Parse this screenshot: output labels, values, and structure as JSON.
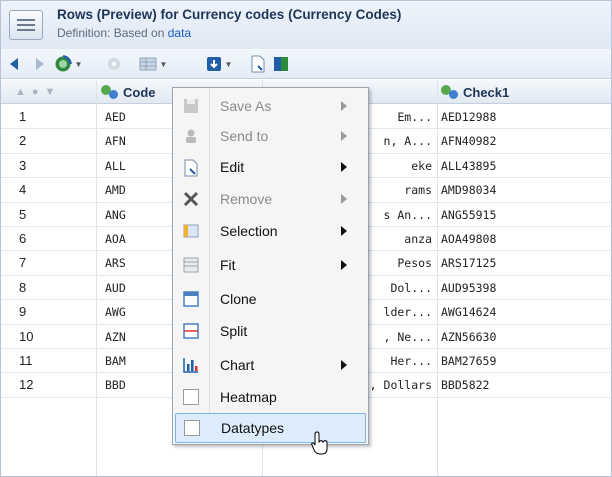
{
  "header": {
    "title": "Rows (Preview) for Currency codes (Currency Codes)",
    "definition_prefix": "Definition: Based on ",
    "definition_link": "data"
  },
  "columns": {
    "code": "Code",
    "check1": "Check1"
  },
  "rows": [
    {
      "num": "1",
      "code": "AED",
      "name": " Em...",
      "check": "AED12988"
    },
    {
      "num": "2",
      "code": "AFN",
      "name": "n, A...",
      "check": "AFN40982"
    },
    {
      "num": "3",
      "code": "ALL",
      "name": "eke",
      "check": "ALL43895"
    },
    {
      "num": "4",
      "code": "AMD",
      "name": "rams",
      "check": "AMD98034"
    },
    {
      "num": "5",
      "code": "ANG",
      "name": "s An...",
      "check": "ANG55915"
    },
    {
      "num": "6",
      "code": "AOA",
      "name": "anza",
      "check": "AOA49808"
    },
    {
      "num": "7",
      "code": "ARS",
      "name": "Pesos",
      "check": "ARS17125"
    },
    {
      "num": "8",
      "code": "AUD",
      "name": "Dol...",
      "check": "AUD95398"
    },
    {
      "num": "9",
      "code": "AWG",
      "name": "lder...",
      "check": "AWG14624"
    },
    {
      "num": "10",
      "code": "AZN",
      "name": ", Ne...",
      "check": "AZN56630"
    },
    {
      "num": "11",
      "code": "BAM",
      "name": "Her...",
      "check": "BAM27659"
    },
    {
      "num": "12",
      "code": "BBD",
      "name": "Barbados, Dollars",
      "check": "BBD5822"
    }
  ],
  "menu": {
    "items": [
      {
        "label": "Save As",
        "disabled": true,
        "submenu": true,
        "icon": "save-icon"
      },
      {
        "label": "Send to",
        "disabled": true,
        "submenu": true,
        "icon": "send-icon"
      },
      {
        "label": "Edit",
        "disabled": false,
        "submenu": true,
        "icon": "edit-icon"
      },
      {
        "label": "Remove",
        "disabled": true,
        "submenu": true,
        "icon": "remove-icon"
      },
      {
        "label": "Selection",
        "disabled": false,
        "submenu": true,
        "icon": "selection-icon"
      },
      {
        "label": "Fit",
        "disabled": false,
        "submenu": true,
        "icon": "fit-icon"
      },
      {
        "label": "Clone",
        "disabled": false,
        "submenu": false,
        "icon": "clone-icon"
      },
      {
        "label": "Split",
        "disabled": false,
        "submenu": false,
        "icon": "split-icon"
      },
      {
        "label": "Chart",
        "disabled": false,
        "submenu": true,
        "icon": "chart-icon"
      },
      {
        "label": "Heatmap",
        "disabled": false,
        "submenu": false,
        "icon": "checkbox"
      },
      {
        "label": "Datatypes",
        "disabled": false,
        "submenu": false,
        "icon": "checkbox",
        "highlighted": true
      }
    ]
  },
  "colors": {
    "accent": "#1a5bbf",
    "title": "#1d3557",
    "highlight_bg": "#dcecfb",
    "highlight_border": "#7eb4ea"
  }
}
